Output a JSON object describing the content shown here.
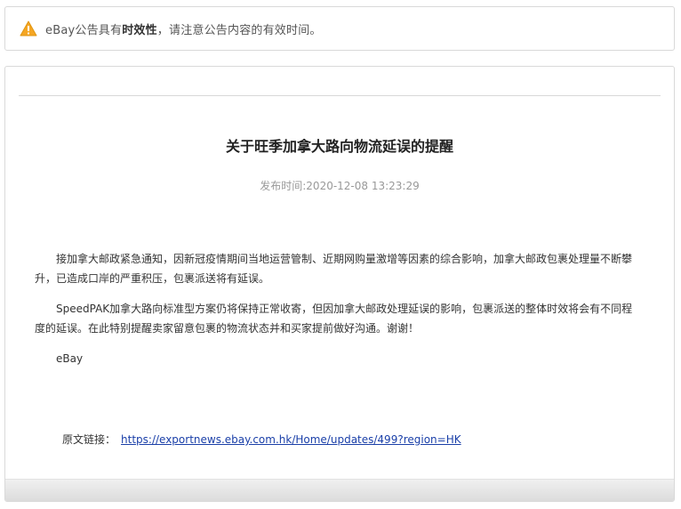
{
  "notice": {
    "prefix": "eBay公告具有",
    "emphasis": "时效性",
    "suffix": "，请注意公告内容的有效时间。",
    "icon": "warning-icon",
    "icon_color": "#f5a623"
  },
  "article": {
    "title": "关于旺季加拿大路向物流延误的提醒",
    "publish_label": "发布时间:",
    "publish_time": "2020-12-08 13:23:29",
    "paragraphs": [
      "接加拿大邮政紧急通知，因新冠疫情期间当地运营管制、近期网购量激增等因素的综合影响，加拿大邮政包裹处理量不断攀升，已造成口岸的严重积压，包裹派送将有延误。",
      "SpeedPAK加拿大路向标准型方案仍将保持正常收寄，但因加拿大邮政处理延误的影响，包裹派送的整体时效将会有不同程度的延误。在此特别提醒卖家留意包裹的物流状态并和买家提前做好沟通。谢谢！",
      "eBay"
    ],
    "source_label": "原文链接：",
    "source_url": "https://exportnews.ebay.com.hk/Home/updates/499?region=HK"
  },
  "colors": {
    "link": "#1a3fa8",
    "border": "#d9d9d9",
    "muted_text": "#999999"
  }
}
